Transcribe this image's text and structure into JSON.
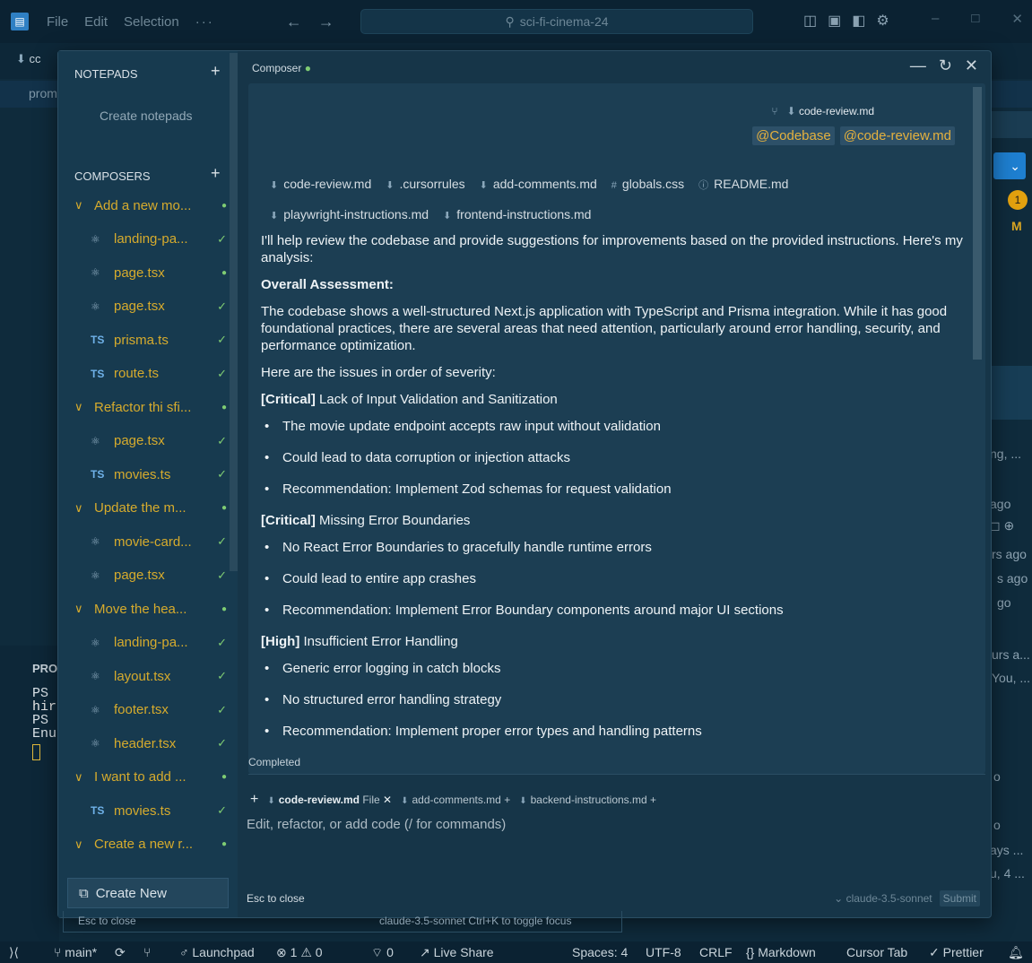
{
  "window": {
    "menu": [
      "File",
      "Edit",
      "Selection",
      "···"
    ],
    "search_text": "sci-fi-cinema-24"
  },
  "background": {
    "tab_label": "cc",
    "sub_text": "prom",
    "problems_label": "PROI",
    "terminal_lines": [
      "PS",
      "hir",
      "PS",
      "Enu"
    ],
    "right_badge": "1",
    "right_m": "M",
    "right_fragments": [
      "ng, ...",
      "ago",
      "rs ago",
      "s ago",
      "go",
      "urs a...",
      "You, ...",
      "o",
      "o",
      "ays ...",
      "u, 4 ..."
    ]
  },
  "sidebar": {
    "notepads_label": "NOTEPADS",
    "create_notepads": "Create notepads",
    "composers_label": "COMPOSERS",
    "items": [
      {
        "kind": "group",
        "label": "Add a new mo..."
      },
      {
        "kind": "file",
        "icon": "react",
        "label": "landing-pa...",
        "status": "check"
      },
      {
        "kind": "file",
        "icon": "react",
        "label": "page.tsx",
        "status": "dot"
      },
      {
        "kind": "file",
        "icon": "react",
        "label": "page.tsx",
        "status": "check"
      },
      {
        "kind": "file",
        "icon": "ts",
        "label": "prisma.ts",
        "status": "check"
      },
      {
        "kind": "file",
        "icon": "ts",
        "label": "route.ts",
        "status": "check"
      },
      {
        "kind": "group",
        "label": "Refactor thi sfi..."
      },
      {
        "kind": "file",
        "icon": "react",
        "label": "page.tsx",
        "status": "check"
      },
      {
        "kind": "file",
        "icon": "ts",
        "label": "movies.ts",
        "status": "check"
      },
      {
        "kind": "group",
        "label": "Update the m..."
      },
      {
        "kind": "file",
        "icon": "react",
        "label": "movie-card...",
        "status": "check"
      },
      {
        "kind": "file",
        "icon": "react",
        "label": "page.tsx",
        "status": "check"
      },
      {
        "kind": "group",
        "label": "Move the hea..."
      },
      {
        "kind": "file",
        "icon": "react",
        "label": "landing-pa...",
        "status": "check"
      },
      {
        "kind": "file",
        "icon": "react",
        "label": "layout.tsx",
        "status": "check"
      },
      {
        "kind": "file",
        "icon": "react",
        "label": "footer.tsx",
        "status": "check"
      },
      {
        "kind": "file",
        "icon": "react",
        "label": "header.tsx",
        "status": "check"
      },
      {
        "kind": "group",
        "label": "I want to add ..."
      },
      {
        "kind": "file",
        "icon": "ts",
        "label": "movies.ts",
        "status": "check"
      },
      {
        "kind": "group",
        "label": "Create a new r..."
      }
    ],
    "create_new_label": "Create New"
  },
  "composer": {
    "title": "Composer",
    "user_file": "code-review.md",
    "mentions": [
      "@Codebase",
      "@code-review.md"
    ],
    "context_files": [
      {
        "icon": "md",
        "name": "code-review.md"
      },
      {
        "icon": "md",
        "name": ".cursorrules"
      },
      {
        "icon": "md",
        "name": "add-comments.md"
      },
      {
        "icon": "hash",
        "name": "globals.css"
      },
      {
        "icon": "info",
        "name": "README.md"
      },
      {
        "icon": "md",
        "name": "playwright-instructions.md"
      },
      {
        "icon": "md",
        "name": "frontend-instructions.md"
      }
    ],
    "intro": "I'll help review the codebase and provide suggestions for improvements based on the provided instructions. Here's my analysis:",
    "overall_heading": "Overall Assessment:",
    "overall_text": "The codebase shows a well-structured Next.js application with TypeScript and Prisma integration. While it has good foundational practices, there are several areas that need attention, particularly around error handling, security, and performance optimization.",
    "issues_intro": "Here are the issues in order of severity:",
    "issues": [
      {
        "severity": "[Critical]",
        "title": "Lack of Input Validation and Sanitization",
        "bullets": [
          "The movie update endpoint accepts raw input without validation",
          "Could lead to data corruption or injection attacks",
          "Recommendation: Implement Zod schemas for request validation"
        ]
      },
      {
        "severity": "[Critical]",
        "title": "Missing Error Boundaries",
        "bullets": [
          "No React Error Boundaries to gracefully handle runtime errors",
          "Could lead to entire app crashes",
          "Recommendation: Implement Error Boundary components around major UI sections"
        ]
      },
      {
        "severity": "[High]",
        "title": "Insufficient Error Handling",
        "bullets": [
          "Generic error logging in catch blocks",
          "No structured error handling strategy",
          "Recommendation: Implement proper error types and handling patterns"
        ]
      }
    ],
    "status": "Completed",
    "attachments": {
      "current": "code-review.md",
      "current_tag": "File",
      "others": [
        "add-comments.md",
        "backend-instructions.md"
      ]
    },
    "input_placeholder": "Edit, refactor, or add code (/ for commands)",
    "esc_hint": "Esc to close",
    "model": "claude-3.5-sonnet",
    "submit_label": "Submit"
  },
  "under_strip": {
    "left": "Esc to close",
    "right": "claude-3.5-sonnet  Ctrl+K to toggle focus"
  },
  "statusbar": {
    "branch": "main*",
    "launchpad": "Launchpad",
    "errors": "1",
    "warnings": "0",
    "ports": "0",
    "live_share": "Live Share",
    "spaces": "Spaces: 4",
    "encoding": "UTF-8",
    "eol": "CRLF",
    "language": "Markdown",
    "cursor_tab": "Cursor Tab",
    "prettier": "Prettier"
  }
}
